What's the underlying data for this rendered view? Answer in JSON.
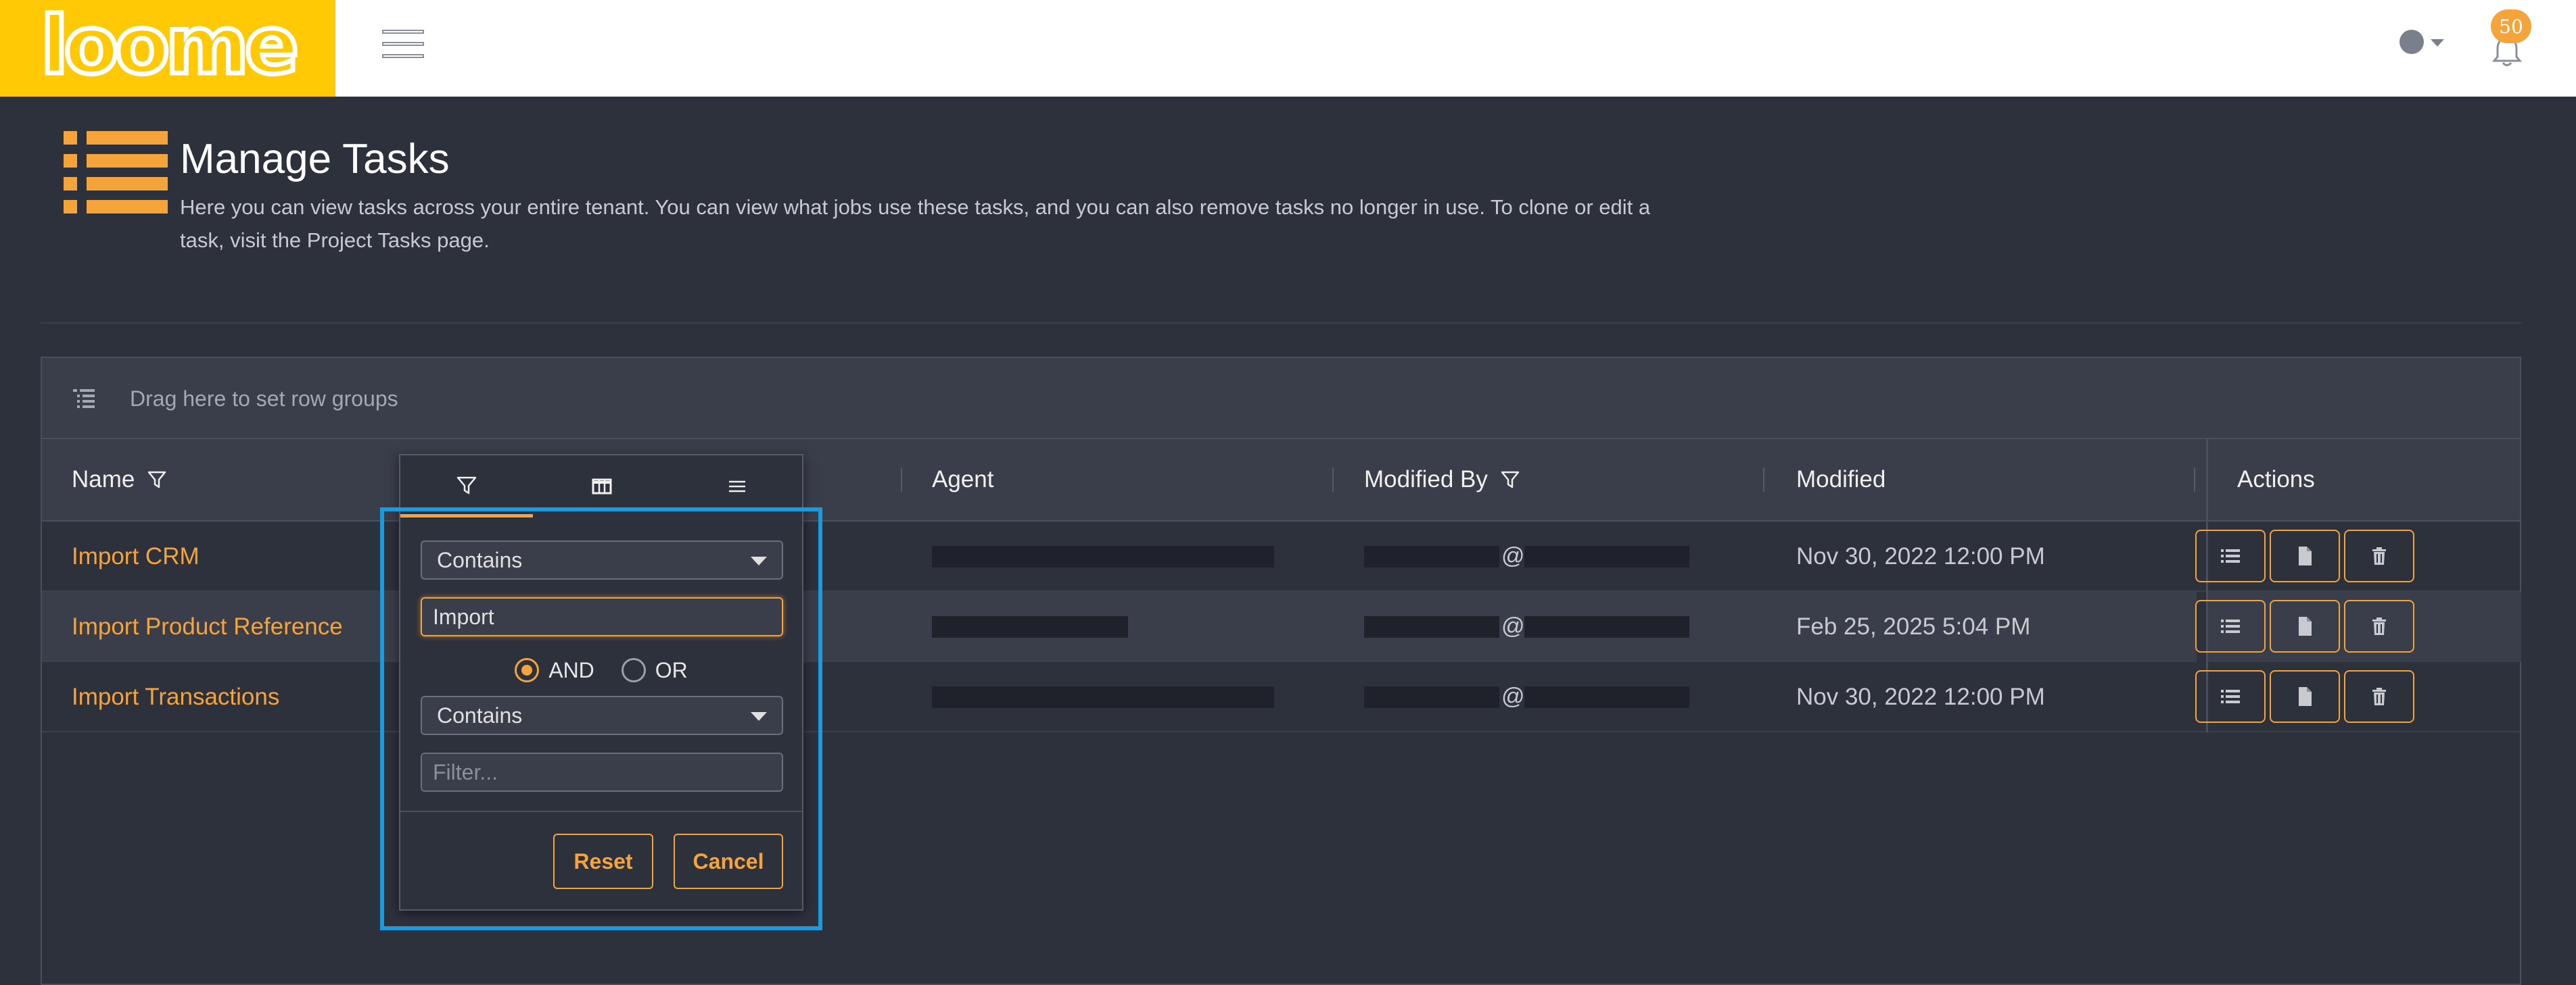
{
  "app": {
    "logo_text": "loome",
    "notification_count": "50"
  },
  "header": {
    "title": "Manage Tasks",
    "description": "Here you can view tasks across your entire tenant. You can view what jobs use these tasks, and you can also remove tasks no longer in use. To clone or edit a task, visit the Project Tasks page."
  },
  "grid": {
    "group_placeholder": "Drag here to set row groups",
    "columns": [
      "Name",
      "",
      "Agent",
      "Modified By",
      "Modified",
      "Actions"
    ],
    "rows": [
      {
        "name": "Import CRM",
        "modified_by_at": "@",
        "modified": "Nov 30, 2022 12:00 PM"
      },
      {
        "name": "Import Product Reference",
        "modified_by_at": "@",
        "modified": "Feb 25, 2025 5:04 PM"
      },
      {
        "name": "Import Transactions",
        "modified_by_at": "@",
        "modified": "Nov 30, 2022 12:00 PM"
      }
    ]
  },
  "filter_popup": {
    "condition1_type": "Contains",
    "condition1_value": "Import",
    "operator_and": "AND",
    "operator_or": "OR",
    "selected_operator": "AND",
    "condition2_type": "Contains",
    "condition2_placeholder": "Filter...",
    "reset_label": "Reset",
    "cancel_label": "Cancel"
  },
  "colors": {
    "accent": "#f5a33b",
    "logo_bg": "#ffc906",
    "focus_ring": "#1c9ae0",
    "background": "#2d313c"
  }
}
